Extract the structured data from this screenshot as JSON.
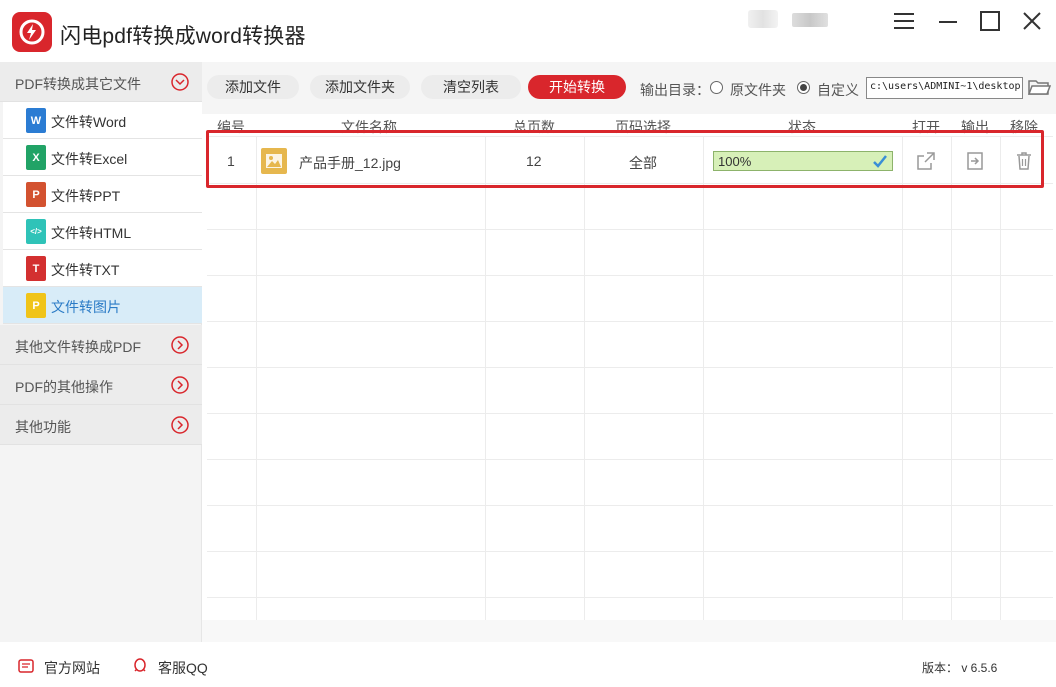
{
  "app": {
    "title": "闪电pdf转换成word转换器",
    "window_controls": [
      "menu-icon",
      "minimize-icon",
      "maximize-icon",
      "close-icon"
    ],
    "accent_color": "#d9262c"
  },
  "sidebar": {
    "groups": [
      {
        "label": "PDF转换成其它文件",
        "expanded": true
      },
      {
        "label": "其他文件转换成PDF",
        "expanded": false
      },
      {
        "label": "PDF的其他操作",
        "expanded": false
      },
      {
        "label": "其他功能",
        "expanded": false
      }
    ],
    "items": [
      {
        "label": "文件转Word",
        "icon": "word-icon",
        "icon_letter": "W",
        "color": "#2b7cd3"
      },
      {
        "label": "文件转Excel",
        "icon": "excel-icon",
        "icon_letter": "X",
        "color": "#21a366"
      },
      {
        "label": "文件转PPT",
        "icon": "ppt-icon",
        "icon_letter": "P",
        "color": "#d35230"
      },
      {
        "label": "文件转HTML",
        "icon": "html-icon",
        "icon_letter": "</>",
        "color": "#2fc3b8"
      },
      {
        "label": "文件转TXT",
        "icon": "txt-icon",
        "icon_letter": "T",
        "color": "#d33030"
      },
      {
        "label": "文件转图片",
        "icon": "image-icon",
        "icon_letter": "P",
        "color": "#f0c419",
        "selected": true
      }
    ]
  },
  "toolbar": {
    "add_file": "添加文件",
    "add_folder": "添加文件夹",
    "clear_list": "清空列表",
    "start": "开始转换",
    "output_dir_label": "输出目录：",
    "option_original": "原文件夹",
    "option_custom": "自定义",
    "selected_option": "自定义",
    "path_value": "c:\\users\\ADMINI~1\\desktop"
  },
  "table": {
    "headers": [
      "编号",
      "文件名称",
      "总页数",
      "页码选择",
      "状态",
      "打开",
      "输出",
      "移除"
    ],
    "rows": [
      {
        "index": "1",
        "filename": "产品手册_12.jpg",
        "pages": "12",
        "page_selection": "全部",
        "status": "100%",
        "progress": 1.0
      }
    ]
  },
  "statusbar": {
    "website": "官方网站",
    "support": "客服QQ",
    "version": "版本： v 6.5.6"
  }
}
